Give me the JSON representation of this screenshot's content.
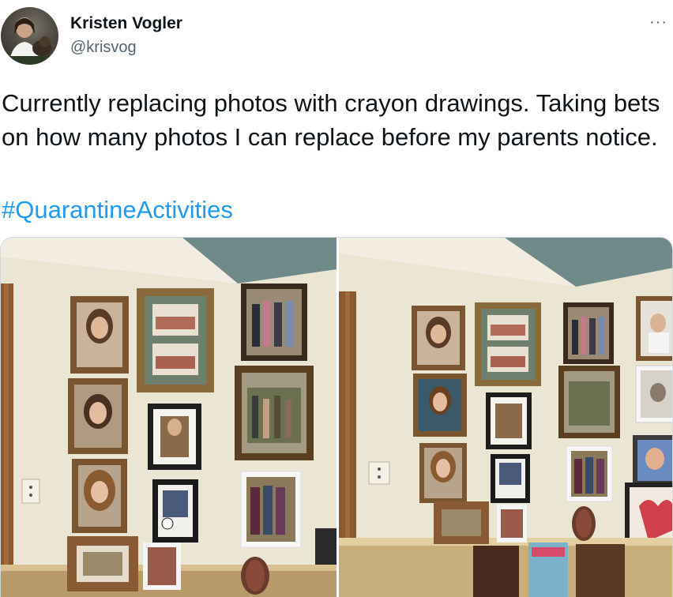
{
  "tweet": {
    "author_name": "Kristen Vogler",
    "author_handle": "@krisvog",
    "more_label": "···",
    "text": "Currently replacing photos with crayon drawings. Taking bets on how many photos I can replace before my parents notice.",
    "hashtag": "#QuarantineActivities"
  },
  "media": {
    "photos": [
      {
        "label": "photo-before",
        "subject": "wall of framed family photos"
      },
      {
        "label": "photo-after",
        "subject": "wall of framed photos with crayon drawings"
      }
    ]
  },
  "colors": {
    "link": "#1d9bf0",
    "text": "#0f1419",
    "secondary": "#536471",
    "wall": "#ece6d6",
    "ceiling": "#6f8a88",
    "frame_wood": "#7a5530"
  },
  "icons": {
    "more": "more-horizontal-icon"
  }
}
